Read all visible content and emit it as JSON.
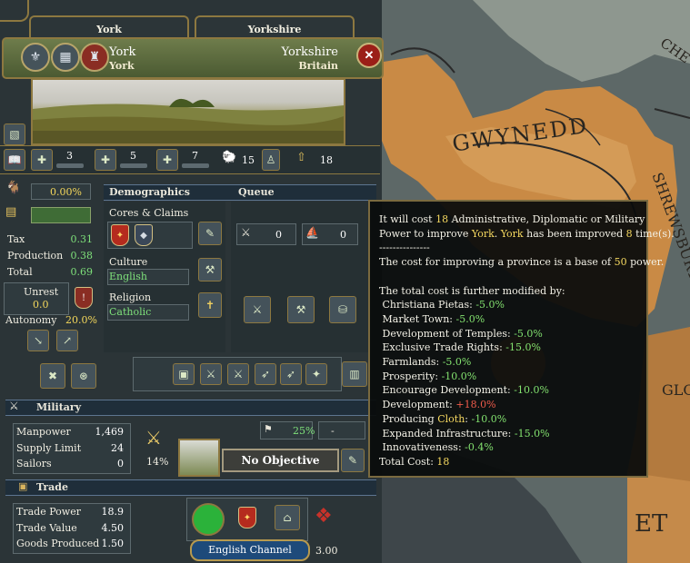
{
  "tabs": {
    "province": "York",
    "state": "Yorkshire"
  },
  "header": {
    "province_name": "York",
    "capital": "York",
    "state_name": "Yorkshire",
    "region": "Britain"
  },
  "buildings_row": {
    "adm": "3",
    "dip": "5",
    "mil": "7",
    "devastation": "15",
    "dev_total": "18"
  },
  "stats": {
    "unrest_pct": "0.00%",
    "tax_label": "Tax",
    "tax_value": "0.31",
    "production_label": "Production",
    "production_value": "0.38",
    "total_label": "Total",
    "total_value": "0.69",
    "unrest_label": "Unrest",
    "unrest_value": "0.0",
    "autonomy_label": "Autonomy",
    "autonomy_value": "20.0%"
  },
  "demographics": {
    "header": "Demographics",
    "queue_header": "Queue",
    "cores_label": "Cores & Claims",
    "culture_label": "Culture",
    "culture_value": "English",
    "religion_label": "Religion",
    "religion_value": "Catholic",
    "queue_a": "0",
    "queue_b": "0"
  },
  "military": {
    "header": "Military",
    "manpower_label": "Manpower",
    "manpower_value": "1,469",
    "supply_label": "Supply Limit",
    "supply_value": "24",
    "sailors_label": "Sailors",
    "sailors_value": "0",
    "fort_pct": "14%",
    "siege_pct": "25%",
    "siege_other": "-",
    "no_objective": "No Objective"
  },
  "trade": {
    "header": "Trade",
    "power_label": "Trade Power",
    "power_value": "18.9",
    "value_label": "Trade Value",
    "value_value": "4.50",
    "goods_label": "Goods Produced",
    "goods_value": "1.50",
    "node": "English Channel",
    "goods_price": "3.00"
  },
  "map_labels": {
    "gwynedd": "GWYNEDD",
    "shrewsbury": "SHREWSBURY",
    "che": "CHE",
    "glo": "GLO",
    "et": "ET"
  },
  "tooltip": {
    "l1a": "It will cost ",
    "l1b": "18",
    "l1c": " Administrative, Diplomatic or Military",
    "l2a": "Power to improve ",
    "l2b": "York",
    "l2c": ". ",
    "l2d": "York",
    "l2e": " has been improved ",
    "l2f": "8",
    "l2g": " time(s).",
    "sep": "---------------",
    "l3a": "The cost for improving a province is a base of ",
    "l3b": "50",
    "l3c": " power.",
    "l4": "The total cost is further modified by:",
    "modifiers": [
      {
        "name": "Christiana Pietas: ",
        "value": "-5.0%"
      },
      {
        "name": "Market Town: ",
        "value": "-5.0%"
      },
      {
        "name": "Development of Temples: ",
        "value": "-5.0%"
      },
      {
        "name": "Exclusive Trade Rights: ",
        "value": "-15.0%"
      },
      {
        "name": "Farmlands: ",
        "value": "-5.0%"
      },
      {
        "name": "Prosperity: ",
        "value": "-10.0%"
      },
      {
        "name": "Encourage Development: ",
        "value": "-10.0%"
      },
      {
        "name": "Development: ",
        "value": "+18.0%"
      },
      {
        "name": "Producing ",
        "good": "Cloth",
        "sep": ": ",
        "value": "-10.0%"
      },
      {
        "name": "Expanded Infrastructure: ",
        "value": "-15.0%"
      },
      {
        "name": "Innovativeness: ",
        "value": "-0.4%"
      }
    ],
    "total_label": "Total Cost: ",
    "total_value": "18"
  },
  "colors": {
    "panel": "#2b3437",
    "accent_gold": "#8d7840",
    "positive": "#7ee07a",
    "negative": "#ef5b4b",
    "highlight": "#f6d960",
    "sea": "#3e464a",
    "land": "#c98a45"
  }
}
